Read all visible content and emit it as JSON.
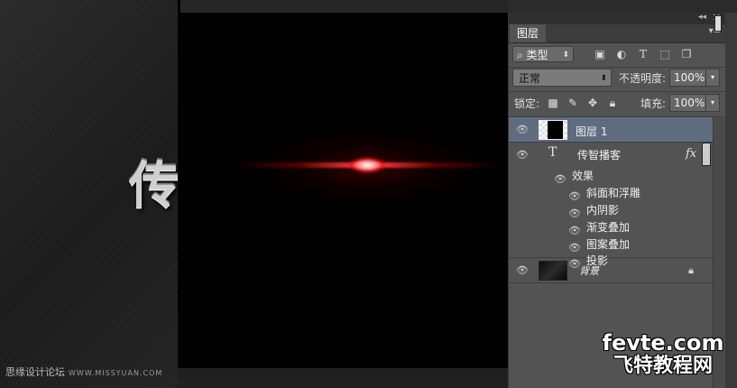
{
  "canvas": {
    "glyph": "传"
  },
  "panel": {
    "tab_label": "图层",
    "icons": {
      "collapse": "double-chevron-left-icon",
      "close": "close-icon",
      "menu": "panel-menu-icon"
    },
    "filter": {
      "kind_label": "类型",
      "kind_icon": "search-icon",
      "filter_icons": [
        "image-filter-icon",
        "adjustment-filter-icon",
        "type-filter-icon",
        "shape-filter-icon",
        "smart-object-filter-icon"
      ]
    },
    "blend_mode": "正常",
    "opacity_label": "不透明度:",
    "opacity_value": "100%",
    "lock_label": "锁定:",
    "lock_icons": [
      "lock-transparent-icon",
      "lock-image-icon",
      "lock-position-icon",
      "lock-all-icon"
    ],
    "fill_label": "填充:",
    "fill_value": "100%"
  },
  "layers": [
    {
      "name": "图层 1",
      "type": "raster",
      "selected": true
    },
    {
      "name": "传智播客",
      "type": "text",
      "fx": "fx",
      "effects_label": "效果",
      "effects": [
        "斜面和浮雕",
        "内阴影",
        "渐变叠加",
        "图案叠加",
        "投影"
      ]
    },
    {
      "name": "背景",
      "type": "background",
      "locked": true
    }
  ],
  "watermarks": {
    "left_cn": "思缘设计论坛",
    "left_url": "WWW.MISSYUAN.COM",
    "right_site": "fevte.com",
    "right_cn": "飞特教程网"
  },
  "colors": {
    "panel_bg": "#535353",
    "selected_row": "#5f6c80",
    "flare_red": "#ff3030"
  }
}
